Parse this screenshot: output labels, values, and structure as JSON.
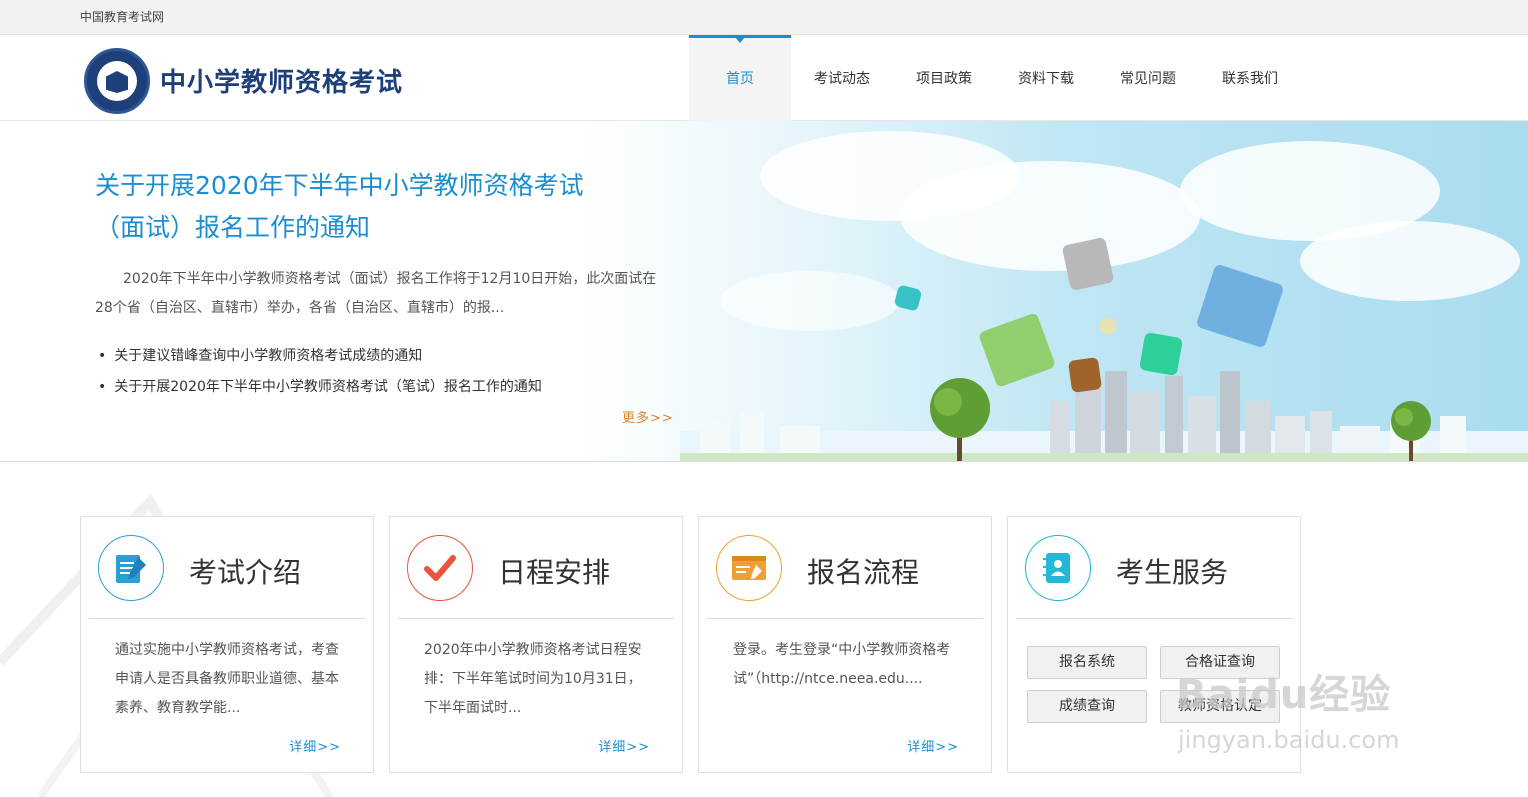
{
  "topbar": {
    "site_name": "中国教育考试网"
  },
  "header": {
    "logo_title": "中小学教师资格考试",
    "nav": [
      {
        "label": "首页",
        "active": true
      },
      {
        "label": "考试动态"
      },
      {
        "label": "项目政策"
      },
      {
        "label": "资料下载"
      },
      {
        "label": "常见问题"
      },
      {
        "label": "联系我们"
      }
    ]
  },
  "banner": {
    "title": "关于开展2020年下半年中小学教师资格考试（面试）报名工作的通知",
    "description": "2020年下半年中小学教师资格考试（面试）报名工作将于12月10日开始，此次面试在28个省（自治区、直辖市）举办，各省（自治区、直辖市）的报...",
    "news": [
      "关于建议错峰查询中小学教师资格考试成绩的通知",
      "关于开展2020年下半年中小学教师资格考试（笔试）报名工作的通知"
    ],
    "more": "更多>>"
  },
  "cards": [
    {
      "title": "考试介绍",
      "icon": "document-edit-icon",
      "text": "通过实施中小学教师资格考试，考查申请人是否具备教师职业道德、基本素养、教育教学能...",
      "more": "详细>>",
      "color": "#2a9fd6"
    },
    {
      "title": "日程安排",
      "icon": "checkmark-icon",
      "text": "2020年中小学教师资格考试日程安排：下半年笔试时间为10月31日，下半年面试时...",
      "more": "详细>>",
      "color": "#e8553a"
    },
    {
      "title": "报名流程",
      "icon": "registration-form-icon",
      "text": "登录。考生登录“中小学教师资格考试”（http://ntce.neea.edu....",
      "more": "详细>>",
      "color": "#f0a030"
    },
    {
      "title": "考生服务",
      "icon": "contacts-book-icon",
      "color": "#22b8d6",
      "buttons": [
        "报名系统",
        "合格证查询",
        "成绩查询",
        "教师资格认定"
      ]
    }
  ],
  "watermark": {
    "main": "Baidu经验",
    "sub": "jingyan.baidu.com"
  }
}
